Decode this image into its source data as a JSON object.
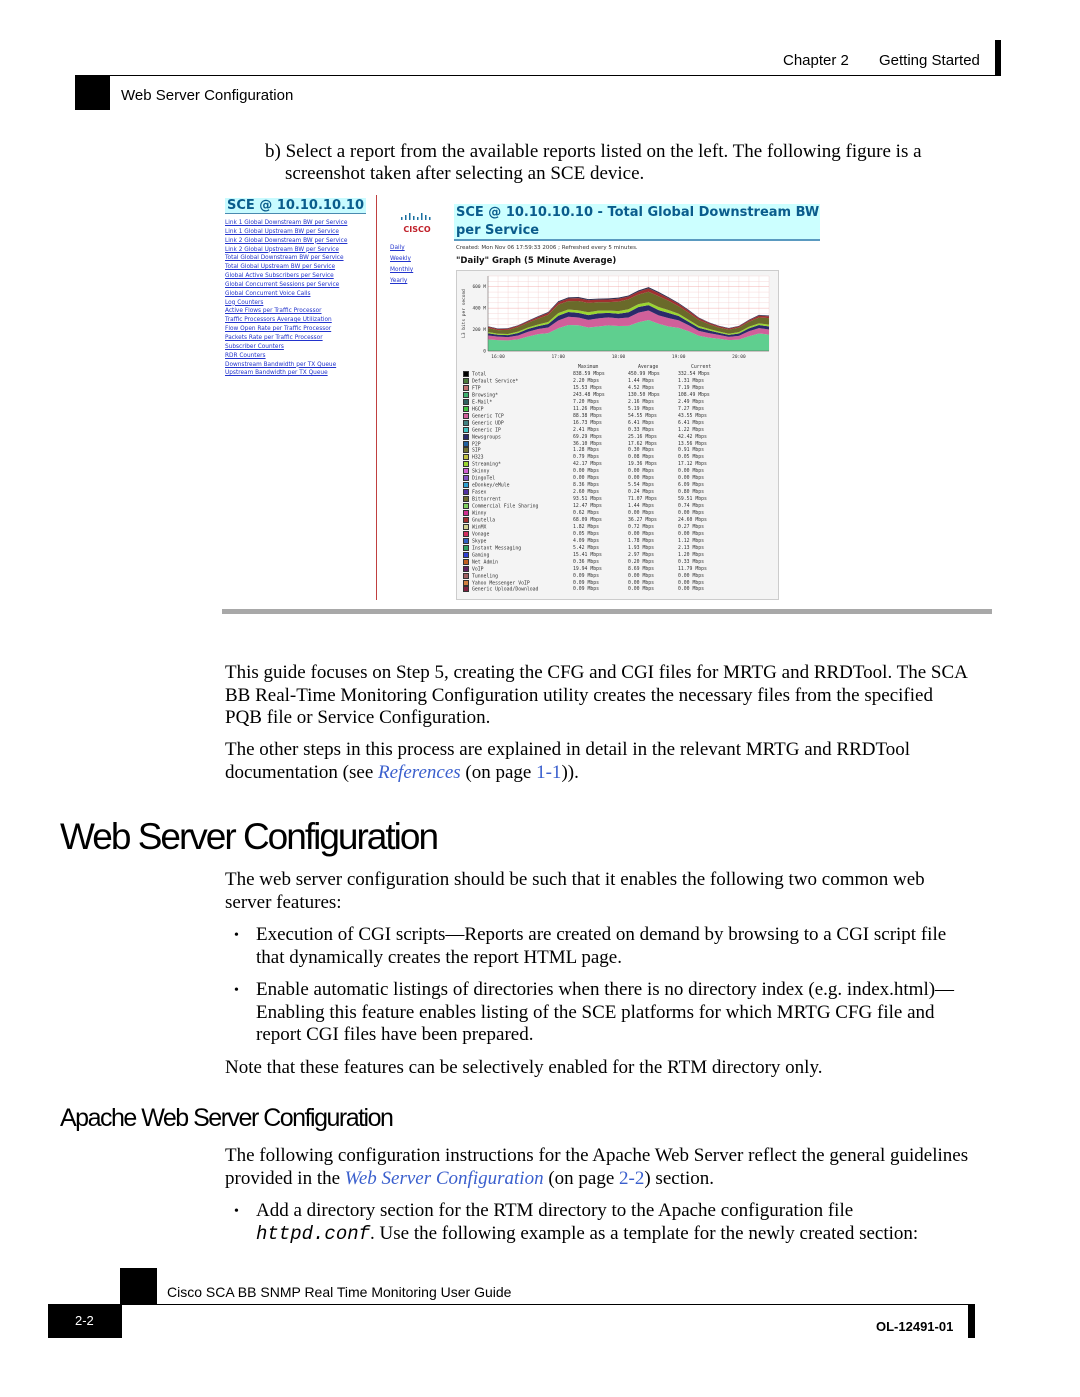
{
  "header": {
    "chapter": "Chapter 2",
    "chapter_title": "Getting Started",
    "section": "Web Server Configuration"
  },
  "intro": {
    "step_b_line1": "b) Select a report from the available reports listed on the left. The following figure is a",
    "step_b_line2": "screenshot taken after selecting an SCE device."
  },
  "screenshot": {
    "left_title": "SCE @ 10.10.10.10",
    "reports": [
      "Link 1 Global Downstream BW per Service",
      "Link 1 Global Upstream BW per Service",
      "Link 2 Global Downstream BW per Service",
      "Link 2 Global Upstream BW per Service",
      "Total Global Downstream BW per Service",
      "Total Global Upstream BW per Service",
      "Global Active Subscribers per Service",
      "Global Concurrent Sessions per Service",
      "Global Concurrent Voice Calls",
      "Log Counters",
      "Active Flows per Traffic Processor",
      "Traffic Processors Average Utilization",
      "Flow Open Rate per Traffic Processor",
      "Packets Rate per Traffic Processor",
      "Subscriber Counters",
      "RDR Counters",
      "Downstream Bandwidth per TX Queue",
      "Upstream Bandwidth per TX Queue"
    ],
    "logo_text": "cisco",
    "periods": [
      "Daily",
      "Weekly",
      "Monthly",
      "Yearly"
    ],
    "report_title": "SCE @ 10.10.10.10 - Total Global Downstream BW per Service",
    "created": "Created: Mon Nov 06 17:59:33 2006 ; Refreshed every 5 minutes.",
    "graph_title": "\"Daily\" Graph (5 Minute Average)",
    "colors": {
      "link": "#2233cc",
      "title": "#0a5c8c",
      "title_bg": "#ccffff"
    }
  },
  "chart_data": {
    "type": "area",
    "stacked": true,
    "ylabel": "L3 bits per second",
    "yticks": [
      "600 M",
      "400 M",
      "200 M",
      "0"
    ],
    "ylim": [
      0,
      700
    ],
    "xticks": [
      "16:00",
      "17:00",
      "18:00",
      "19:00",
      "20:00"
    ],
    "x": [
      "15:50",
      "16:00",
      "16:10",
      "16:20",
      "16:30",
      "16:40",
      "16:50",
      "17:00",
      "17:10",
      "17:20",
      "17:30",
      "17:40",
      "17:50",
      "18:00",
      "18:10",
      "18:20",
      "18:30",
      "18:40",
      "18:50",
      "19:00",
      "19:10",
      "19:20",
      "19:30",
      "19:40",
      "19:50",
      "20:00",
      "20:10",
      "20:20",
      "20:30"
    ],
    "total": [
      230,
      205,
      215,
      245,
      280,
      320,
      370,
      470,
      490,
      500,
      495,
      490,
      480,
      500,
      530,
      560,
      585,
      560,
      510,
      440,
      380,
      320,
      270,
      230,
      215,
      240,
      290,
      330,
      335
    ],
    "series": [
      {
        "name": "Browsing*",
        "color": "#5fcf8f",
        "share": 0.47
      },
      {
        "name": "Generic TCP",
        "color": "#d0609a",
        "share": 0.15
      },
      {
        "name": "Newsgroups",
        "color": "#2a2a6a",
        "share": 0.09
      },
      {
        "name": "Streaming*",
        "color": "#9ad630",
        "share": 0.05
      },
      {
        "name": "Bittorrent",
        "color": "#6a6a2a",
        "share": 0.17
      },
      {
        "name": "Gnutella",
        "color": "#a03030",
        "share": 0.05
      },
      {
        "name": "Total",
        "color": "#303050",
        "share": 0.02
      }
    ],
    "legend": {
      "columns": [
        "Maximum",
        "Average",
        "Current"
      ],
      "rows": [
        {
          "name": "Total",
          "color": "#000000",
          "max": "838.59 Mbps",
          "avg": "450.99 Mbps",
          "cur": "332.54 Mbps"
        },
        {
          "name": "Default Service*",
          "color": "#4a7a3a",
          "max": "2.20 Mbps",
          "avg": "1.44 Mbps",
          "cur": "1.31 Mbps"
        },
        {
          "name": "FTP",
          "color": "#c07070",
          "max": "15.53 Mbps",
          "avg": "4.52 Mbps",
          "cur": "7.19 Mbps"
        },
        {
          "name": "Browsing*",
          "color": "#3fb06f",
          "max": "243.48 Mbps",
          "avg": "130.50 Mbps",
          "cur": "108.49 Mbps"
        },
        {
          "name": "E-Mail*",
          "color": "#2f6060",
          "max": "7.20 Mbps",
          "avg": "2.16 Mbps",
          "cur": "2.49 Mbps"
        },
        {
          "name": "HGCP",
          "color": "#40c040",
          "max": "11.26 Mbps",
          "avg": "5.19 Mbps",
          "cur": "7.27 Mbps"
        },
        {
          "name": "Generic TCP",
          "color": "#d0609a",
          "max": "88.38 Mbps",
          "avg": "54.55 Mbps",
          "cur": "43.55 Mbps"
        },
        {
          "name": "Generic UDP",
          "color": "#408080",
          "max": "16.73 Mbps",
          "avg": "6.41 Mbps",
          "cur": "6.41 Mbps"
        },
        {
          "name": "Generic IP",
          "color": "#40c0c0",
          "max": "2.41 Mbps",
          "avg": "0.33 Mbps",
          "cur": "1.22 Mbps"
        },
        {
          "name": "Newsgroups",
          "color": "#2a2a6a",
          "max": "69.29 Mbps",
          "avg": "25.16 Mbps",
          "cur": "42.42 Mbps"
        },
        {
          "name": "P2P",
          "color": "#2060a0",
          "max": "36.10 Mbps",
          "avg": "17.62 Mbps",
          "cur": "13.56 Mbps"
        },
        {
          "name": "SIP",
          "color": "#707030",
          "max": "1.28 Mbps",
          "avg": "0.30 Mbps",
          "cur": "0.91 Mbps"
        },
        {
          "name": "H323",
          "color": "#c0c040",
          "max": "0.79 Mbps",
          "avg": "0.08 Mbps",
          "cur": "0.05 Mbps"
        },
        {
          "name": "Streaming*",
          "color": "#9ad630",
          "max": "42.17 Mbps",
          "avg": "19.36 Mbps",
          "cur": "17.12 Mbps"
        },
        {
          "name": "Skinny",
          "color": "#d060d0",
          "max": "0.00 Mbps",
          "avg": "0.00 Mbps",
          "cur": "0.00 Mbps"
        },
        {
          "name": "DingoTel",
          "color": "#8050c0",
          "max": "0.00 Mbps",
          "avg": "0.00 Mbps",
          "cur": "0.00 Mbps"
        },
        {
          "name": "eDonkey/eMule",
          "color": "#30a0d0",
          "max": "8.36 Mbps",
          "avg": "5.54 Mbps",
          "cur": "6.09 Mbps"
        },
        {
          "name": "Fasex",
          "color": "#5030a0",
          "max": "2.60 Mbps",
          "avg": "0.24 Mbps",
          "cur": "0.80 Mbps"
        },
        {
          "name": "Bittorrent",
          "color": "#6a6a2a",
          "max": "93.51 Mbps",
          "avg": "71.07 Mbps",
          "cur": "59.51 Mbps"
        },
        {
          "name": "Commercial File Sharing",
          "color": "#80d060",
          "max": "12.47 Mbps",
          "avg": "1.44 Mbps",
          "cur": "0.74 Mbps"
        },
        {
          "name": "Winny",
          "color": "#d03090",
          "max": "0.62 Mbps",
          "avg": "0.00 Mbps",
          "cur": "0.00 Mbps"
        },
        {
          "name": "Gnutella",
          "color": "#a03030",
          "max": "68.09 Mbps",
          "avg": "36.27 Mbps",
          "cur": "24.60 Mbps"
        },
        {
          "name": "WinMX",
          "color": "#d0d090",
          "max": "1.82 Mbps",
          "avg": "0.72 Mbps",
          "cur": "0.27 Mbps"
        },
        {
          "name": "Vonage",
          "color": "#d03060",
          "max": "0.05 Mbps",
          "avg": "0.00 Mbps",
          "cur": "0.00 Mbps"
        },
        {
          "name": "Skype",
          "color": "#3060c0",
          "max": "4.09 Mbps",
          "avg": "1.78 Mbps",
          "cur": "1.12 Mbps"
        },
        {
          "name": "Instant Messaging",
          "color": "#30a060",
          "max": "5.42 Mbps",
          "avg": "1.93 Mbps",
          "cur": "2.13 Mbps"
        },
        {
          "name": "Gaming",
          "color": "#3040d0",
          "max": "15.41 Mbps",
          "avg": "2.97 Mbps",
          "cur": "1.20 Mbps"
        },
        {
          "name": "Net Admin",
          "color": "#c06020",
          "max": "0.36 Mbps",
          "avg": "0.20 Mbps",
          "cur": "0.33 Mbps"
        },
        {
          "name": "VoIP",
          "color": "#602060",
          "max": "19.94 Mbps",
          "avg": "8.69 Mbps",
          "cur": "11.79 Mbps"
        },
        {
          "name": "Tunneling",
          "color": "#a06060",
          "max": "0.09 Mbps",
          "avg": "0.00 Mbps",
          "cur": "0.00 Mbps"
        },
        {
          "name": "Yahoo Messenger VoIP",
          "color": "#d08040",
          "max": "0.09 Mbps",
          "avg": "0.00 Mbps",
          "cur": "0.00 Mbps"
        },
        {
          "name": "Generic Upload/Download",
          "color": "#802040",
          "max": "0.09 Mbps",
          "avg": "0.00 Mbps",
          "cur": "0.00 Mbps"
        }
      ]
    }
  },
  "para1": {
    "l1": "This guide focuses on Step 5, creating the CFG and CGI files for MRTG and RRDTool. The SCA",
    "l2": "BB Real-Time Monitoring Configuration utility creates the necessary files from the specified",
    "l3": "PQB file or Service Configuration."
  },
  "para2": {
    "l1": "The other steps in this process are explained in detail in the relevant MRTG and RRDTool",
    "l2_pre": "documentation (see ",
    "l2_link": "References",
    "l2_mid": " (on page ",
    "l2_page": "1-1",
    "l2_post": "))."
  },
  "section1": {
    "title": "Web Server Configuration",
    "p1_l1": "The web server configuration should be such that it enables the following two common web",
    "p1_l2": "server features:",
    "b1_l1": "Execution of CGI scripts—Reports are created on demand by browsing to a CGI script file",
    "b1_l2": "that dynamically creates the report HTML page.",
    "b2_l1": "Enable automatic listings of directories when there is no directory index (e.g. index.html)—",
    "b2_l2": "Enabling this feature enables listing of the SCE platforms for which MRTG CFG file and",
    "b2_l3": "report CGI files have been prepared.",
    "note": "Note that these features can be selectively enabled for the RTM directory only."
  },
  "section2": {
    "title": "Apache Web Server Configuration",
    "p1_l1": "The following configuration instructions for the Apache Web Server reflect the general guidelines",
    "p1_l2_pre": "provided in the ",
    "p1_l2_link": "Web Server Configuration",
    "p1_l2_mid": " (on page ",
    "p1_l2_page": "2-2",
    "p1_l2_post": ") section.",
    "b1_l1": "Add a directory section for the RTM directory to the Apache configuration file",
    "b1_l2_code": "httpd.conf",
    "b1_l2_post": ". Use the following example as a template for the newly created section:"
  },
  "bullet": "•",
  "footer": {
    "guide": "Cisco SCA BB SNMP Real Time Monitoring User Guide",
    "page": "2-2",
    "doc_id": "OL-12491-01"
  }
}
